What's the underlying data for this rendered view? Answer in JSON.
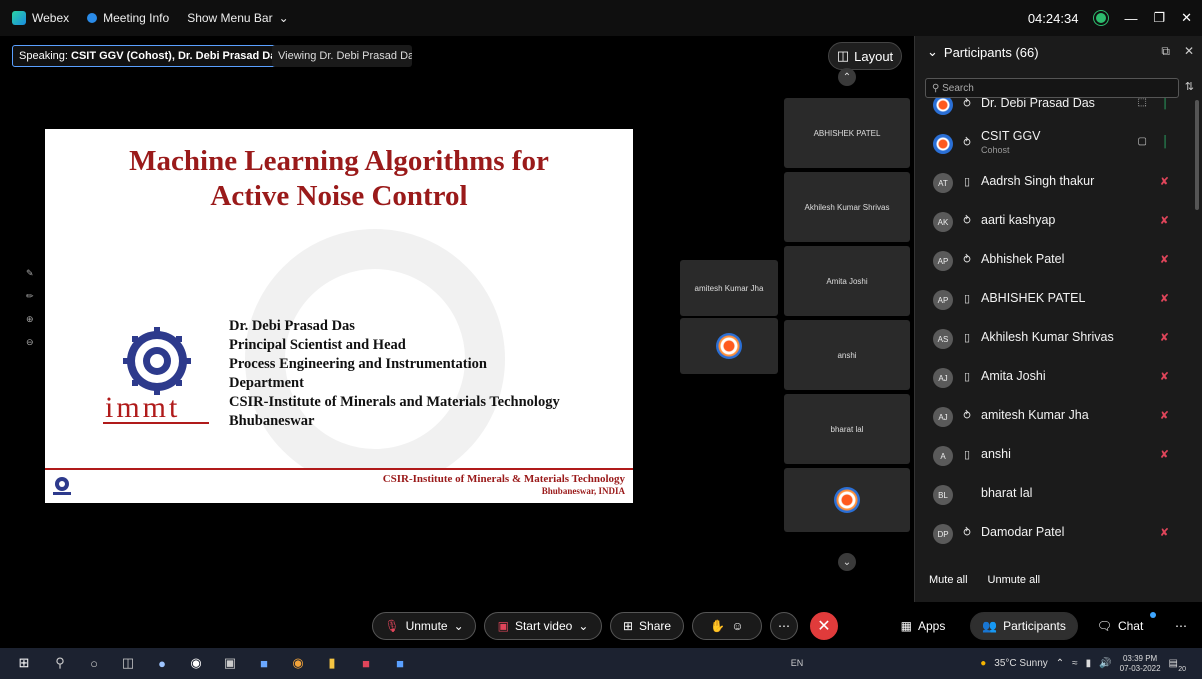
{
  "titlebar": {
    "app_name": "Webex",
    "meeting_info": "Meeting Info",
    "show_menu_bar": "Show Menu Bar",
    "time": "04:24:34"
  },
  "stage": {
    "speaking_prefix": "Speaking:",
    "speaking_names": "CSIT GGV (Cohost), Dr. Debi Prasad Das",
    "viewing": "Viewing Dr. Debi Prasad Das'...",
    "layout_label": "Layout"
  },
  "slide": {
    "title_line1": "Machine Learning Algorithms for",
    "title_line2": "Active Noise Control",
    "logo_text": "immt",
    "author_lines": [
      "Dr. Debi Prasad Das",
      "Principal Scientist and Head",
      "Process Engineering and Instrumentation",
      "Department",
      "CSIR-Institute of Minerals and Materials Technology",
      "Bhubaneswar"
    ],
    "footer_line1": "CSIR-Institute of Minerals & Materials Technology",
    "footer_line2": "Bhubaneswar, INDIA"
  },
  "video_tiles": [
    {
      "label": "ABHISHEK PATEL"
    },
    {
      "label": "Akhilesh Kumar Shrivas"
    },
    {
      "label": "Amita Joshi"
    },
    {
      "label": "anshi"
    },
    {
      "label": "bharat lal"
    },
    {
      "label": "amitesh Kumar Jha"
    }
  ],
  "participants": {
    "header": "Participants (66)",
    "search_placeholder": "Search",
    "list": [
      {
        "initials": "",
        "name": "Dr. Debi Prasad Das",
        "sub": "",
        "mark": "headset",
        "video": "share",
        "mic": "on"
      },
      {
        "initials": "",
        "name": "CSIT GGV",
        "sub": "Cohost",
        "mark": "headset",
        "video": "video",
        "mic": "on"
      },
      {
        "initials": "AT",
        "name": "Aadrsh Singh thakur",
        "sub": "",
        "mark": "phone",
        "video": "",
        "mic": "muted"
      },
      {
        "initials": "AK",
        "name": "aarti kashyap",
        "sub": "",
        "mark": "headset",
        "video": "",
        "mic": "muted"
      },
      {
        "initials": "AP",
        "name": "Abhishek Patel",
        "sub": "",
        "mark": "headset",
        "video": "",
        "mic": "muted"
      },
      {
        "initials": "AP",
        "name": "ABHISHEK PATEL",
        "sub": "",
        "mark": "phone",
        "video": "",
        "mic": "muted"
      },
      {
        "initials": "AS",
        "name": "Akhilesh Kumar Shrivas",
        "sub": "",
        "mark": "phone",
        "video": "",
        "mic": "muted"
      },
      {
        "initials": "AJ",
        "name": "Amita Joshi",
        "sub": "",
        "mark": "phone",
        "video": "",
        "mic": "muted"
      },
      {
        "initials": "AJ",
        "name": "amitesh Kumar Jha",
        "sub": "",
        "mark": "headset",
        "video": "",
        "mic": "muted"
      },
      {
        "initials": "A",
        "name": "anshi",
        "sub": "",
        "mark": "phone",
        "video": "",
        "mic": "muted"
      },
      {
        "initials": "BL",
        "name": "bharat lal",
        "sub": "",
        "mark": "",
        "video": "",
        "mic": ""
      },
      {
        "initials": "DP",
        "name": "Damodar Patel",
        "sub": "",
        "mark": "headset",
        "video": "",
        "mic": "muted"
      }
    ],
    "mute_all": "Mute all",
    "unmute_all": "Unmute all"
  },
  "controls": {
    "unmute": "Unmute",
    "start_video": "Start video",
    "share": "Share",
    "apps": "Apps",
    "participants": "Participants",
    "chat": "Chat"
  },
  "taskbar": {
    "lang": "EN",
    "weather": "35°C Sunny",
    "time": "03:39 PM",
    "date": "07-03-2022",
    "notif_count": "20"
  },
  "colors": {
    "accent_blue": "#5aa0ff",
    "leave_red": "#e03b3b",
    "slide_red": "#9a1a1a",
    "mic_muted": "#e0455a",
    "mic_on": "#2dbd6e"
  }
}
